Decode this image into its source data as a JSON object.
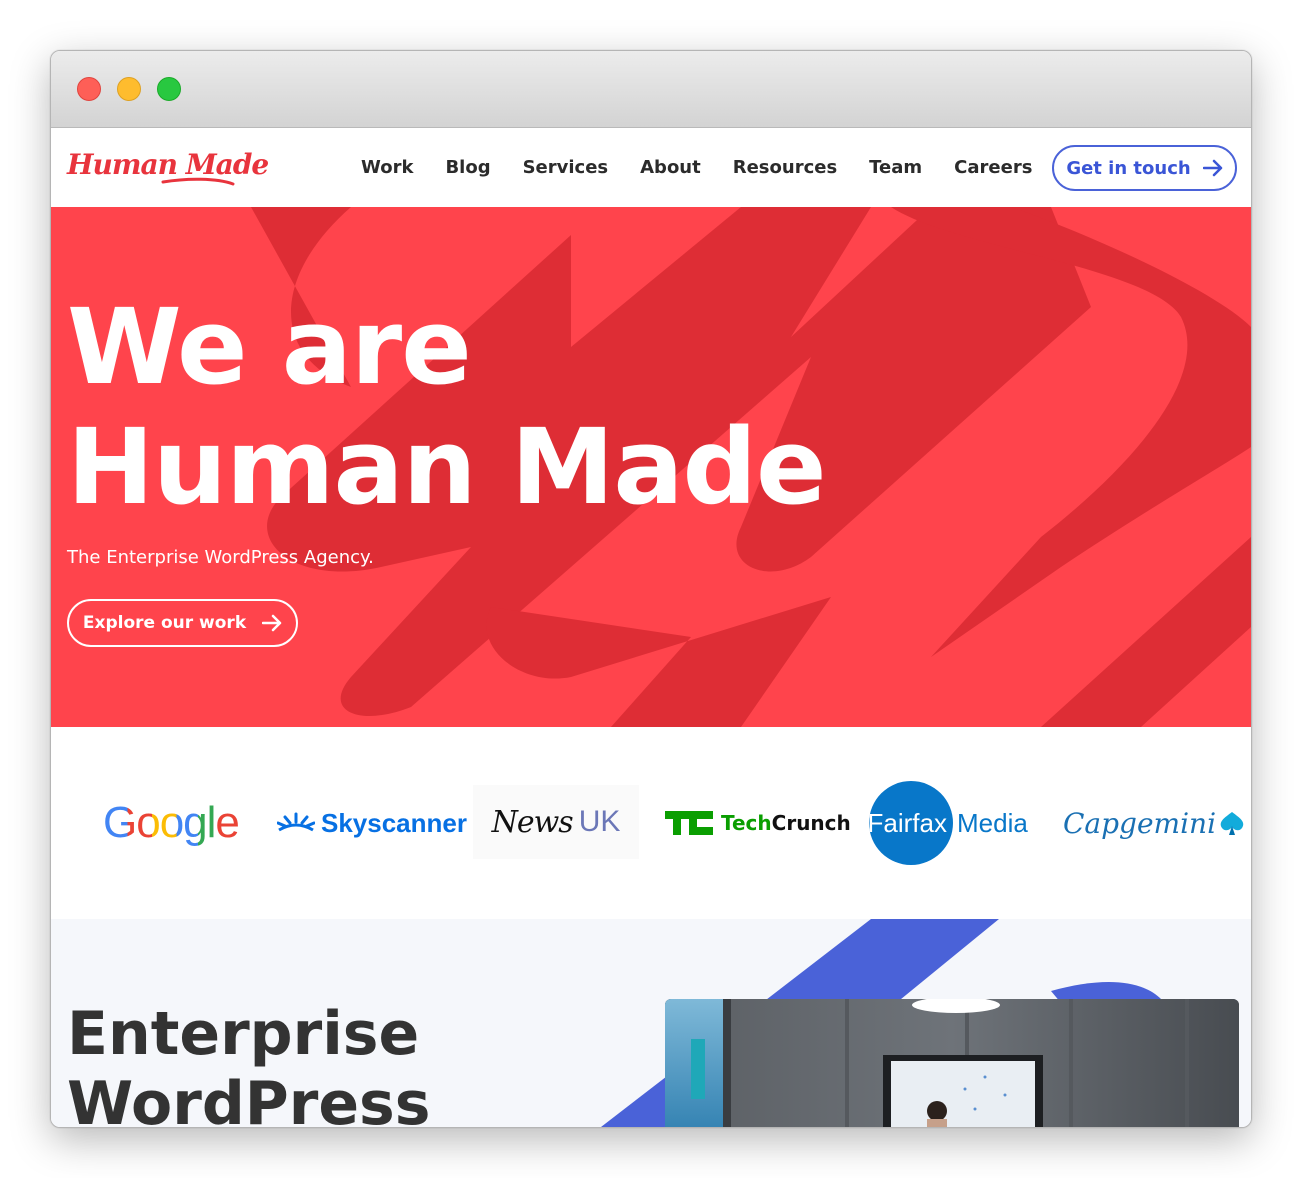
{
  "window": {
    "controls": [
      "close",
      "minimize",
      "maximize"
    ]
  },
  "nav": {
    "logo": "Human Made",
    "links": [
      "Work",
      "Blog",
      "Services",
      "About",
      "Resources",
      "Team",
      "Careers"
    ],
    "cta_label": "Get in touch",
    "cta_icon": "arrow-right-icon"
  },
  "hero": {
    "title_line1": "We are",
    "title_line2": "Human Made",
    "subtitle": "The Enterprise WordPress Agency.",
    "button_label": "Explore our work",
    "button_icon": "arrow-right-icon"
  },
  "clients": {
    "google": "Google",
    "skyscanner": "Skyscanner",
    "newsuk_1": "News",
    "newsuk_2": "UK",
    "techcrunch_1": "Tech",
    "techcrunch_2": "Crunch",
    "fairfax_1": "Fairfax",
    "fairfax_2": "Media",
    "capgemini": "Capgemini"
  },
  "section2": {
    "title_line1": "Enterprise",
    "title_line2": "WordPress"
  },
  "colors": {
    "brand_red": "#ff444c",
    "brand_red_dark": "#de2d35",
    "accent_blue": "#4a62d8",
    "text_dark": "#2b2b2b"
  }
}
